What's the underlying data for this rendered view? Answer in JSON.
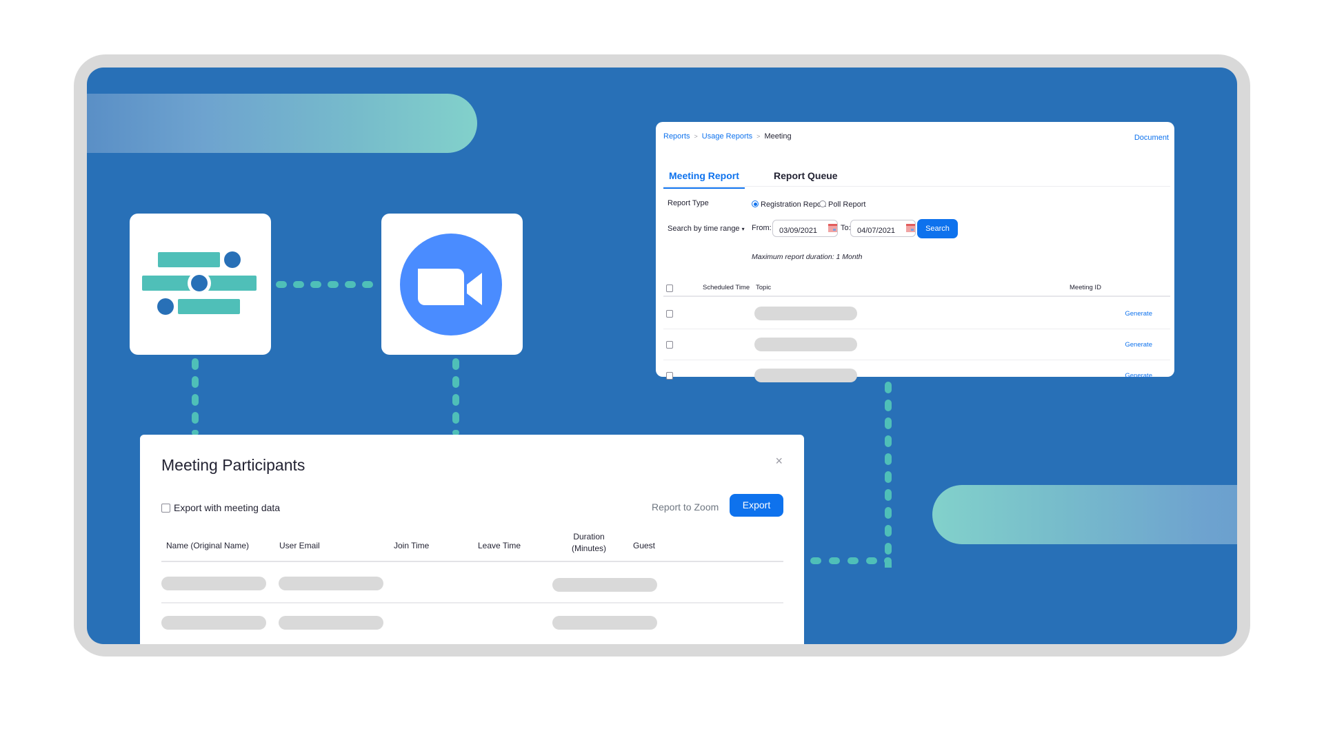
{
  "colors": {
    "frame": "#d9d9d9",
    "panel_blue": "#2870b7",
    "accent_teal": "#4fbfb8",
    "zoom_blue": "#4a8cff",
    "link_blue": "#0e72ed",
    "skeleton": "#d9d9d9"
  },
  "icons": {
    "integration_app": "sliders-icon",
    "zoom_app": "video-camera-icon"
  },
  "report_card": {
    "breadcrumb": [
      "Reports",
      "Usage Reports",
      "Meeting"
    ],
    "breadcrumb_separator": ">",
    "document_link": "Document",
    "tabs": [
      {
        "label": "Meeting Report",
        "active": true
      },
      {
        "label": "Report Queue",
        "active": false
      }
    ],
    "report_type_label": "Report Type",
    "report_type_options": [
      {
        "label": "Registration Report",
        "selected": true
      },
      {
        "label": "Poll Report",
        "selected": false
      }
    ],
    "search_mode": "Search by time range",
    "from_label": "From:",
    "from_value": "03/09/2021",
    "to_label": "To:",
    "to_value": "04/07/2021",
    "search_button": "Search",
    "hint": "Maximum report duration: 1 Month",
    "columns": [
      "Scheduled Time",
      "Topic",
      "Meeting ID"
    ],
    "rows": [
      {
        "action": "Generate"
      },
      {
        "action": "Generate"
      },
      {
        "action": "Generate"
      }
    ]
  },
  "modal": {
    "title": "Meeting Participants",
    "close": "×",
    "export_checkbox_label": "Export with meeting data",
    "report_link": "Report to Zoom",
    "export_button": "Export",
    "columns": [
      "Name (Original Name)",
      "User Email",
      "Join Time",
      "Leave Time",
      "Duration\n(Minutes)",
      "Guest"
    ],
    "duration_line1": "Duration",
    "duration_line2": "(Minutes)",
    "row_count": 2
  }
}
